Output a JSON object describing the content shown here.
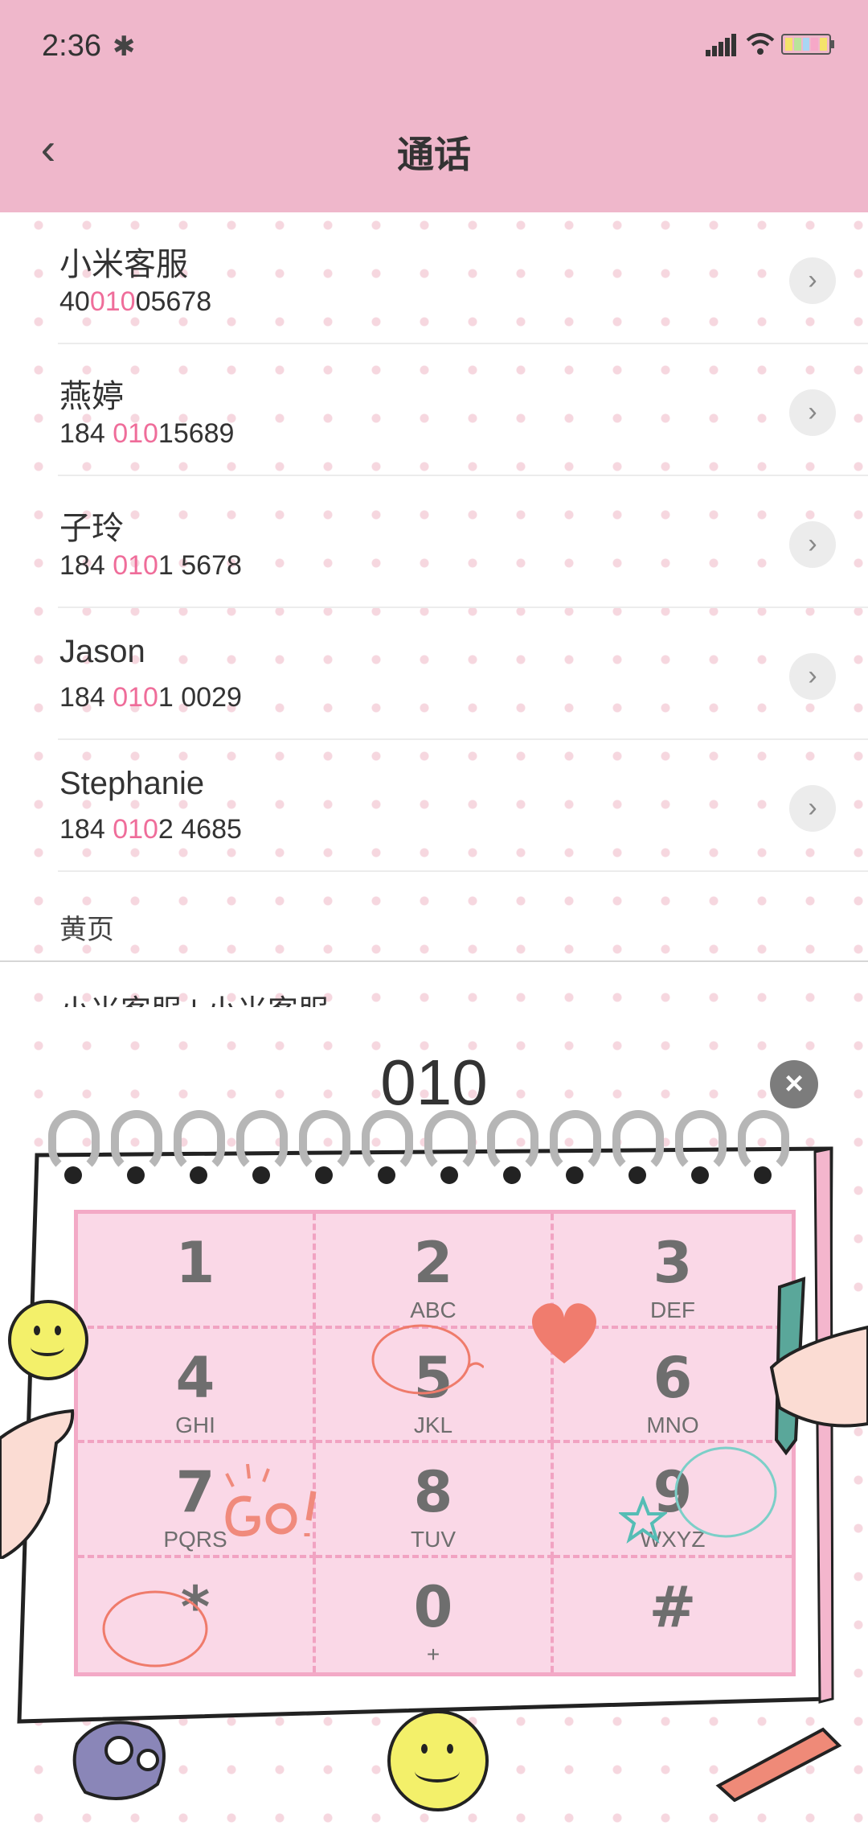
{
  "status_bar": {
    "time": "2:36",
    "bluetooth_icon": "bluetooth-icon",
    "signal_icon": "signal-icon",
    "wifi_icon": "wifi-icon",
    "battery_icon": "battery-icon"
  },
  "header": {
    "title": "通话",
    "back_icon": "chevron-left-icon"
  },
  "contacts": [
    {
      "name": "小米客服",
      "num_pre": "40",
      "num_hl": "010",
      "num_post": "05678"
    },
    {
      "name": "燕婷",
      "num_pre": "184 ",
      "num_hl": "010",
      "num_post": "15689"
    },
    {
      "name": "子玲",
      "num_pre": "184 ",
      "num_hl": "010",
      "num_post": "1 5678"
    },
    {
      "name": "Jason",
      "num_pre": "184 ",
      "num_hl": "010",
      "num_post": "1 0029"
    },
    {
      "name": "Stephanie",
      "num_pre": "184 ",
      "num_hl": "010",
      "num_post": "2 4685"
    }
  ],
  "yellow_pages": {
    "header": "黄页",
    "partial_item": "小米客服 | 小米客服"
  },
  "dialer": {
    "input": "010",
    "clear_icon": "close-icon",
    "keys": [
      {
        "digit": "1",
        "letters": "",
        "name": "key-1"
      },
      {
        "digit": "2",
        "letters": "ABC",
        "name": "key-2"
      },
      {
        "digit": "3",
        "letters": "DEF",
        "name": "key-3"
      },
      {
        "digit": "4",
        "letters": "GHI",
        "name": "key-4"
      },
      {
        "digit": "5",
        "letters": "JKL",
        "name": "key-5"
      },
      {
        "digit": "6",
        "letters": "MNO",
        "name": "key-6"
      },
      {
        "digit": "7",
        "letters": "PQRS",
        "name": "key-7"
      },
      {
        "digit": "8",
        "letters": "TUV",
        "name": "key-8"
      },
      {
        "digit": "9",
        "letters": "WXYZ",
        "name": "key-9"
      },
      {
        "digit": "*",
        "letters": "",
        "name": "key-star"
      },
      {
        "digit": "0",
        "letters": "+",
        "name": "key-0"
      },
      {
        "digit": "#",
        "letters": "",
        "name": "key-hash"
      }
    ]
  },
  "colors": {
    "header_bg": "#efb7cb",
    "highlight": "#ef6d9a",
    "keypad_bg": "#fad8e7"
  }
}
